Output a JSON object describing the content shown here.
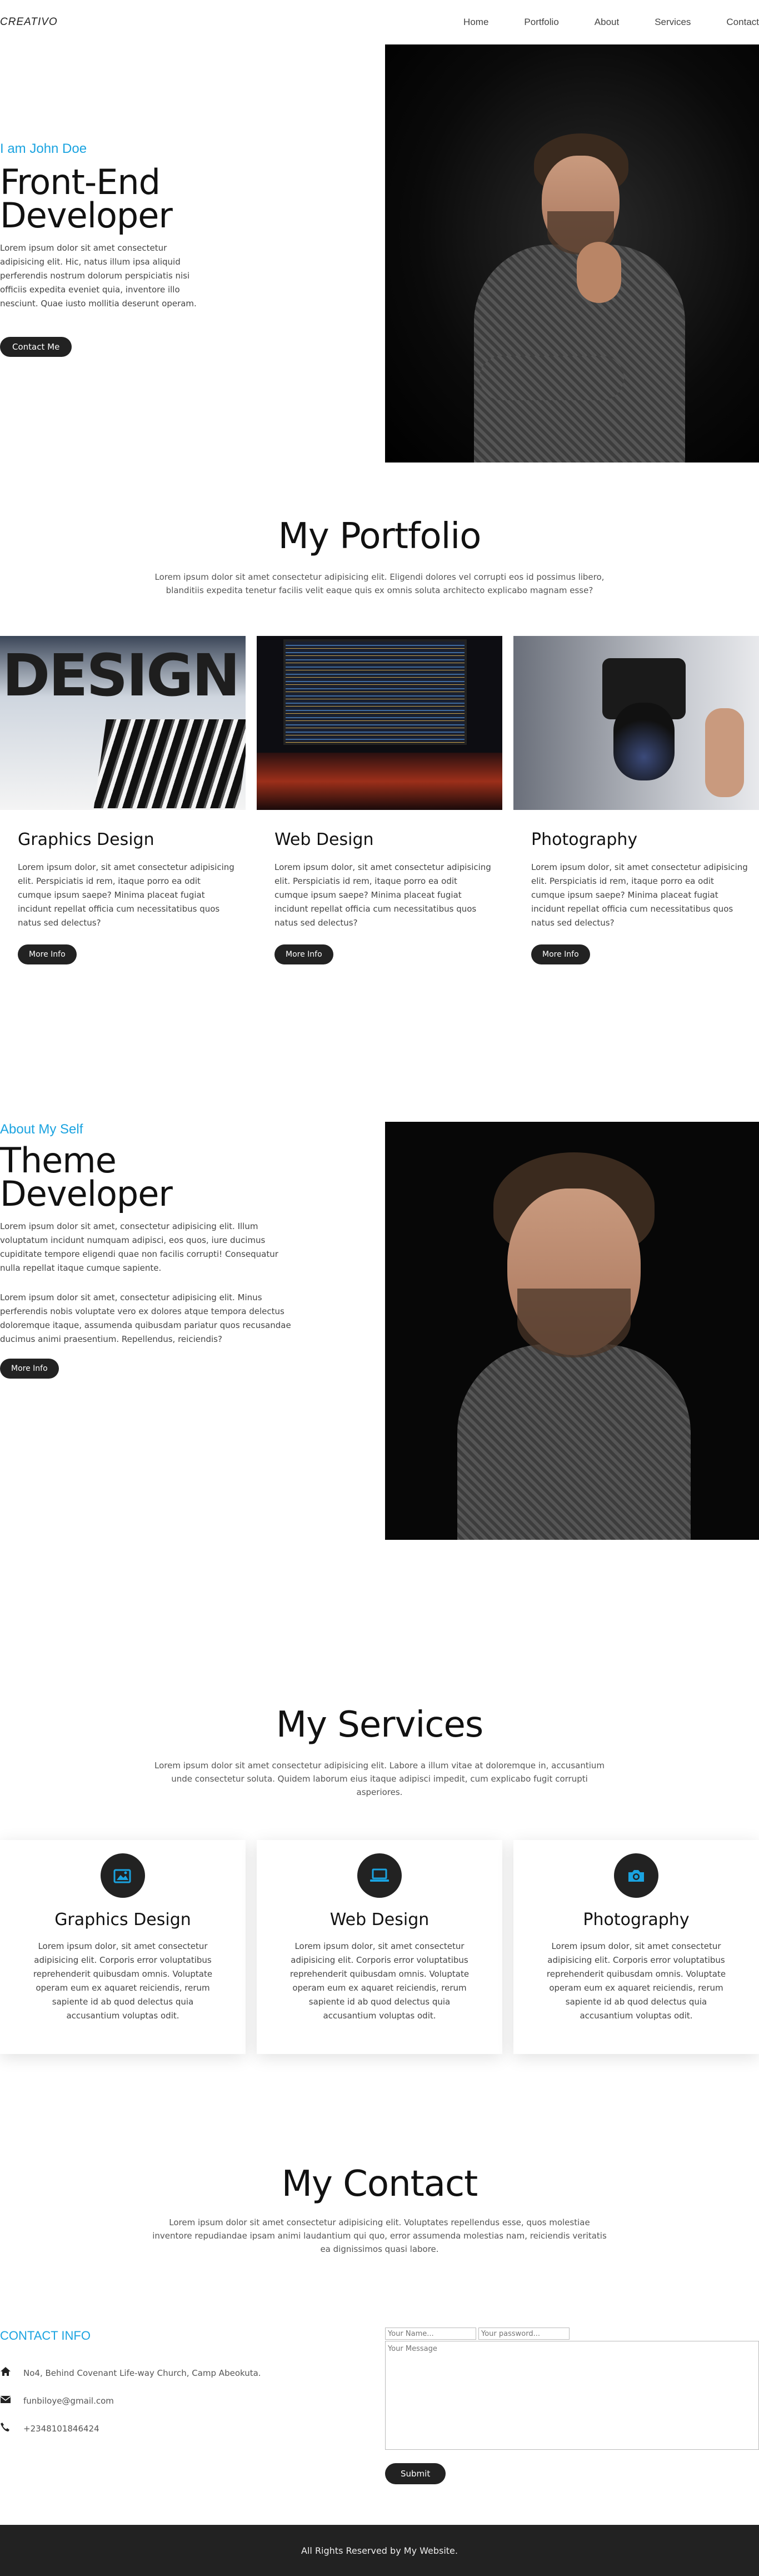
{
  "nav": {
    "logo": "CREATIVO",
    "links": [
      "Home",
      "Portfolio",
      "About",
      "Services",
      "Contact"
    ]
  },
  "hero": {
    "eyebrow": "I am John Doe",
    "title_line1": "Front-End",
    "title_line2": "Developer",
    "paragraph": "Lorem ipsum dolor sit amet consectetur adipisicing elit. Hic, natus illum ipsa aliquid perferendis nostrum dolorum perspiciatis nisi officiis expedita eveniet quia, inventore illo nesciunt. Quae iusto mollitia deserunt operam.",
    "button": "Contact Me"
  },
  "portfolio": {
    "title": "My Portfolio",
    "subtitle": "Lorem ipsum dolor sit amet consectetur adipisicing elit. Eligendi dolores vel corrupti eos id possimus libero, blanditiis expedita tenetur facilis velit eaque quis ex omnis soluta architecto explicabo magnam esse?",
    "cards": [
      {
        "title": "Graphics Design",
        "text": "Lorem ipsum dolor, sit amet consectetur adipisicing elit. Perspiciatis id rem, itaque porro ea odit cumque ipsum saepe? Minima placeat fugiat incidunt repellat officia cum necessitatibus quos natus sed delectus?",
        "button": "More Info",
        "image_word": "DESIGN"
      },
      {
        "title": "Web Design",
        "text": "Lorem ipsum dolor, sit amet consectetur adipisicing elit. Perspiciatis id rem, itaque porro ea odit cumque ipsum saepe? Minima placeat fugiat incidunt repellat officia cum necessitatibus quos natus sed delectus?",
        "button": "More Info"
      },
      {
        "title": "Photography",
        "text": "Lorem ipsum dolor, sit amet consectetur adipisicing elit. Perspiciatis id rem, itaque porro ea odit cumque ipsum saepe? Minima placeat fugiat incidunt repellat officia cum necessitatibus quos natus sed delectus?",
        "button": "More Info"
      }
    ]
  },
  "about": {
    "eyebrow": "About My Self",
    "title_line1": "Theme",
    "title_line2": "Developer",
    "paragraph1": "Lorem ipsum dolor sit amet, consectetur adipisicing elit. Illum voluptatum incidunt numquam adipisci, eos quos, iure ducimus cupiditate tempore eligendi quae non facilis corrupti! Consequatur nulla repellat itaque cumque sapiente.",
    "paragraph2": "Lorem ipsum dolor sit amet, consectetur adipisicing elit. Minus perferendis nobis voluptate vero ex dolores atque tempora delectus doloremque itaque, assumenda quibusdam pariatur quos recusandae ducimus animi praesentium. Repellendus, reiciendis?",
    "button": "More Info"
  },
  "services": {
    "title": "My Services",
    "subtitle": "Lorem ipsum dolor sit amet consectetur adipisicing elit. Labore a illum vitae at doloremque in, accusantium unde consectetur soluta. Quidem laborum eius itaque adipisci impedit, cum explicabo fugit corrupti asperiores.",
    "cards": [
      {
        "title": "Graphics Design",
        "icon": "image-icon",
        "text": "Lorem ipsum dolor, sit amet consectetur adipisicing elit. Corporis error voluptatibus reprehenderit quibusdam omnis. Voluptate operam eum ex aquaret reiciendis, rerum sapiente id ab quod delectus quia accusantium voluptas odit."
      },
      {
        "title": "Web Design",
        "icon": "laptop-icon",
        "text": "Lorem ipsum dolor, sit amet consectetur adipisicing elit. Corporis error voluptatibus reprehenderit quibusdam omnis. Voluptate operam eum ex aquaret reiciendis, rerum sapiente id ab quod delectus quia accusantium voluptas odit."
      },
      {
        "title": "Photography",
        "icon": "camera-icon",
        "text": "Lorem ipsum dolor, sit amet consectetur adipisicing elit. Corporis error voluptatibus reprehenderit quibusdam omnis. Voluptate operam eum ex aquaret reiciendis, rerum sapiente id ab quod delectus quia accusantium voluptas odit."
      }
    ],
    "icon_color": "#1aa3e0"
  },
  "contact": {
    "title": "My Contact",
    "subtitle": "Lorem ipsum dolor sit amet consectetur adipisicing elit. Voluptates repellendus esse, quos molestiae inventore repudiandae ipsam animi laudantium qui quo, error assumenda molestias nam, reiciendis veritatis ea dignissimos quasi labore.",
    "info_heading": "CONTACT INFO",
    "address": "No4, Behind Covenant Life-way Church, Camp Abeokuta.",
    "email": "funbiloye@gmail.com",
    "phone": "+2348101846424",
    "form": {
      "name_placeholder": "Your Name...",
      "password_placeholder": "Your password...",
      "message_placeholder": "Your Message",
      "submit": "Submit"
    }
  },
  "footer": {
    "text": "All Rights Reserved by My Website."
  },
  "colors": {
    "accent": "#1aa3e0",
    "dark": "#222222"
  }
}
